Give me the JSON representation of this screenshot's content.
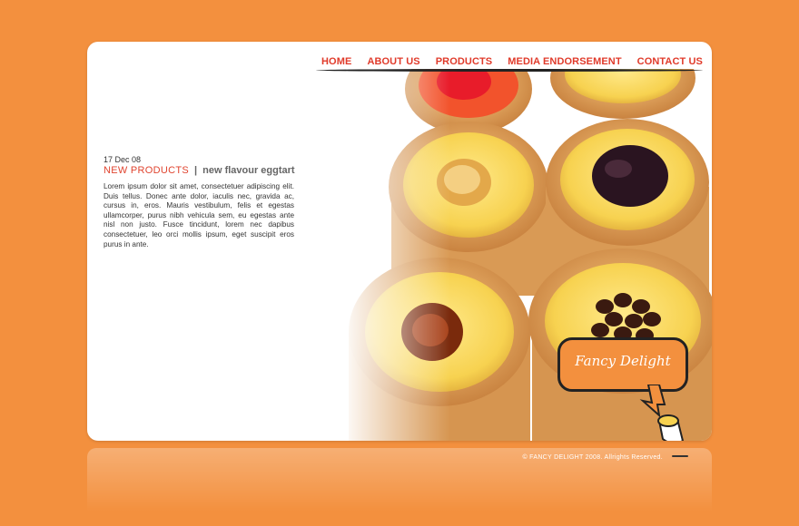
{
  "nav": {
    "items": [
      "HOME",
      "ABOUT US",
      "PRODUCTS",
      "MEDIA ENDORSEMENT",
      "CONTACT US"
    ]
  },
  "post": {
    "date": "17 Dec 08",
    "category": "NEW PRODUCTS",
    "separator": "|",
    "title": "new flavour eggtart",
    "body": "Lorem ipsum dolor sit amet, consectetuer adipiscing elit. Duis tellus. Donec ante dolor, iaculis nec, gravida ac, cursus in, eros. Mauris vestibulum, felis et egestas ullamcorper, purus nibh vehicula sem, eu egestas ante nisl non justo. Fusce tincidunt, lorem nec dapibus consectetuer, leo orci mollis ipsum, eget suscipit eros purus in ante."
  },
  "logo": {
    "text": "Fancy Delight"
  },
  "footer": {
    "copyright": "© FANCY DELIGHT 2008. Allrights Reserved."
  },
  "colors": {
    "background": "#f3903e",
    "nav_link": "#e03a2a",
    "category": "#e0442f"
  }
}
